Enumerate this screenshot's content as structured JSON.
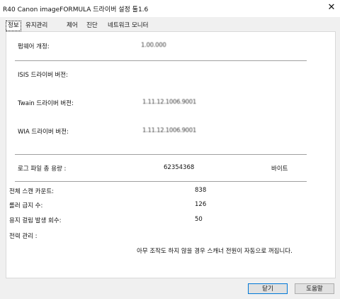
{
  "window": {
    "title": "R40 Canon imageFORMULA 드라이버 설정 툴1.6",
    "close_glyph": "✕"
  },
  "tabs": [
    {
      "label": "정보",
      "active": true
    },
    {
      "label": "유지관리",
      "active": false
    },
    {
      "label": "제어",
      "active": false
    },
    {
      "label": "진단",
      "active": false
    },
    {
      "label": "네트워크 모니터",
      "active": false
    }
  ],
  "info": {
    "firmware_label": "펌웨어 개정:",
    "firmware_value": "1.00.000",
    "isis_label": "ISIS 드라이버 버전:",
    "twain_label": "Twain 드라이버 버전:",
    "twain_value": "1.11.12.1006.9001",
    "wia_label": "WIA 드라이버 버전:",
    "wia_value": "1.11.12.1006.9001",
    "log_label": "로그 파일 총 용량 :",
    "log_value": "62354368",
    "log_unit": "바이트",
    "total_scan_label": "전체 스캔 카운트:",
    "total_scan_value": "838",
    "roller_label": "롤러 급지 수:",
    "roller_value": "126",
    "paperjam_label": "용지 걸림 발생 회수:",
    "paperjam_value": "50",
    "power_label": "전력 관리 :",
    "power_text": "아무 조작도 하지 않을 경우 스캐너 전원이 자동으로 꺼집니다."
  },
  "buttons": {
    "close_label": "닫기",
    "help_label": "도움말"
  }
}
